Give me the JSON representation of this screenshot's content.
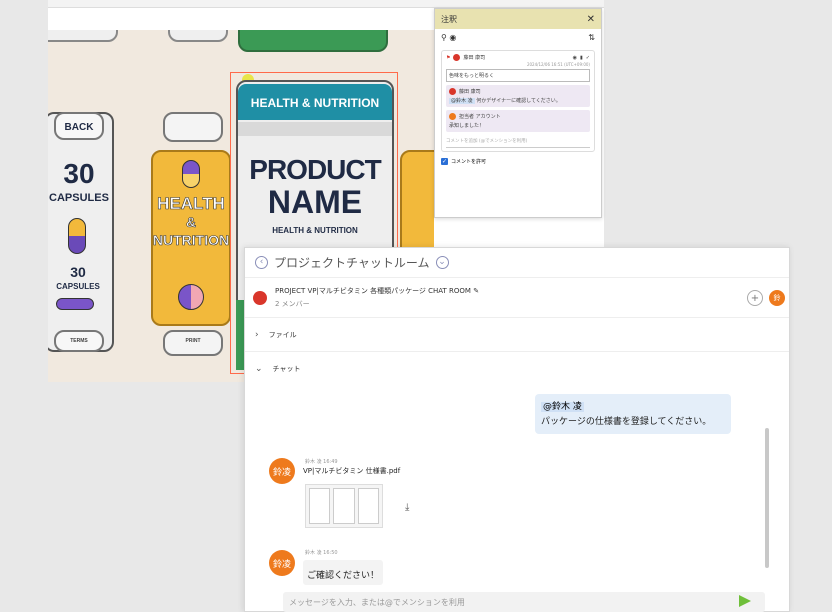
{
  "annotation_panel": {
    "title": "注釈",
    "close_label": "✕",
    "comment": {
      "author": "藤田 康司",
      "timestamp": "2024/12/06 16:51 (UTC+09:00)",
      "text": "色味をもっと明るく",
      "replies": [
        {
          "author": "藤田 康司",
          "mention": "@鈴木 凌",
          "text": "何かデザイナーに確認してください。"
        },
        {
          "author": "担当者 アカウント",
          "text": "承知しました！"
        }
      ]
    },
    "add_comment_placeholder": "コメントを追加 (@でメンションを利用)",
    "allow_comment_label": "コメントを許可",
    "allow_comment_checked": true
  },
  "package_art": {
    "back_box": {
      "top_label": "BACK",
      "count": "30",
      "unit": "CAPSULES",
      "bottom_count": "30",
      "bottom_unit": "CAPSULES"
    },
    "side_box": {
      "line1": "HEALTH",
      "line2": "&",
      "line3": "NUTRITION"
    },
    "front_box": {
      "banner": "HEALTH & NUTRITION",
      "name_line1": "PRODUCT",
      "name_line2": "NAME",
      "sub": "HEALTH & NUTRITION"
    },
    "bottom_labels": [
      "TERMS",
      "PRINT"
    ]
  },
  "chat": {
    "title": "プロジェクトチャットルーム",
    "room_name": "PROJECT VP|マルチビタミン 各種類パッケージ CHAT ROOM",
    "members": "2 メンバー",
    "sections": {
      "files": "ファイル",
      "chat": "チャット"
    },
    "messages": [
      {
        "mention": "@鈴木 凌",
        "text": "パッケージの仕様書を登録してください。"
      },
      {
        "avatar": "鈴凌",
        "meta": "鈴木 凌 16:49",
        "file_name": "VP|マルチビタミン 仕様書.pdf"
      },
      {
        "avatar": "鈴凌",
        "meta": "鈴木 凌 16:50",
        "text": "ご確認ください！"
      }
    ],
    "header_avatar": "鈴",
    "input_placeholder": "メッセージを入力、または@でメンションを利用"
  }
}
